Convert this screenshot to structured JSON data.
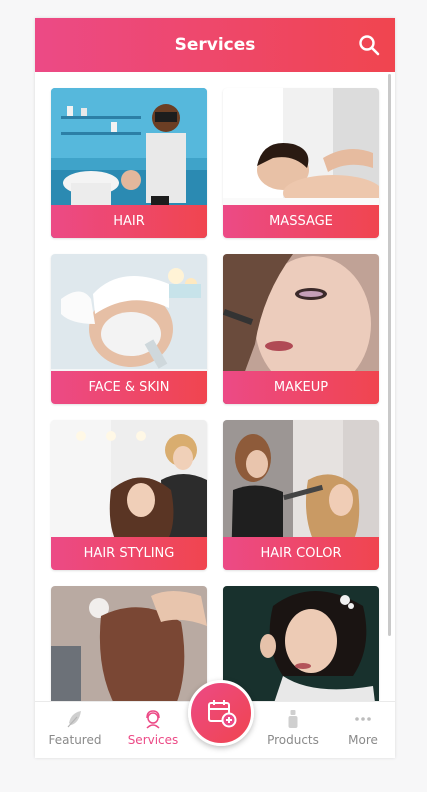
{
  "header": {
    "title": "Services"
  },
  "services": [
    {
      "label": "HAIR"
    },
    {
      "label": "MASSAGE"
    },
    {
      "label": "FACE & SKIN"
    },
    {
      "label": "MAKEUP"
    },
    {
      "label": "HAIR STYLING"
    },
    {
      "label": "HAIR COLOR"
    },
    {
      "label": ""
    },
    {
      "label": ""
    }
  ],
  "tabbar": {
    "items": [
      {
        "label": "Featured",
        "icon": "feather-icon"
      },
      {
        "label": "Services",
        "icon": "woman-face-icon"
      },
      {
        "label": "",
        "icon": "calendar-add-icon"
      },
      {
        "label": "Products",
        "icon": "bottle-icon"
      },
      {
        "label": "More",
        "icon": "more-dots-icon"
      }
    ],
    "active": "Services"
  },
  "colors": {
    "accent_start": "#ec4a86",
    "accent_end": "#f0454f",
    "inactive_text": "#8a8a8a"
  }
}
